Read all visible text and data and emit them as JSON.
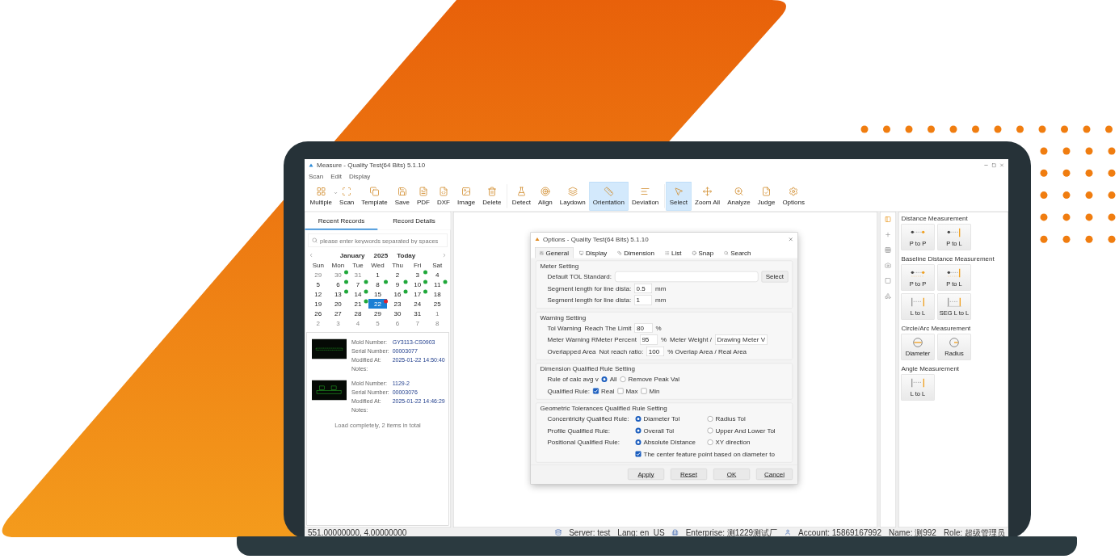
{
  "window": {
    "title": "Measure - Quality Test(64 Bits) 5.1.10"
  },
  "menu": [
    "Scan",
    "Edit",
    "Display"
  ],
  "toolbar": [
    {
      "items": [
        {
          "label": "Multiple",
          "selected": false,
          "dropdown": true
        },
        {
          "label": "Scan",
          "selected": false,
          "dropdown": false
        },
        {
          "label": "Template",
          "selected": false,
          "dropdown": false
        },
        {
          "label": "Save",
          "selected": false,
          "dropdown": false
        },
        {
          "label": "PDF",
          "selected": false,
          "dropdown": false
        },
        {
          "label": "DXF",
          "selected": false,
          "dropdown": false
        },
        {
          "label": "Image",
          "selected": false,
          "dropdown": false
        },
        {
          "label": "Delete",
          "selected": false,
          "dropdown": false
        }
      ]
    },
    {
      "items": [
        {
          "label": "Detect",
          "selected": false,
          "dropdown": false
        },
        {
          "label": "Align",
          "selected": false,
          "dropdown": false
        },
        {
          "label": "Laydown",
          "selected": false,
          "dropdown": false
        },
        {
          "label": "Orientation",
          "selected": true,
          "dropdown": false
        },
        {
          "label": "Deviation",
          "selected": false,
          "dropdown": false
        }
      ]
    },
    {
      "items": [
        {
          "label": "Select",
          "selected": true,
          "dropdown": false
        },
        {
          "label": "Zoom All",
          "selected": false,
          "dropdown": false
        },
        {
          "label": "Analyze",
          "selected": false,
          "dropdown": false
        },
        {
          "label": "Judge",
          "selected": false,
          "dropdown": false
        },
        {
          "label": "Options",
          "selected": false,
          "dropdown": false
        }
      ]
    }
  ],
  "left_panel": {
    "tabs": [
      {
        "label": "Recent Records",
        "selected": true
      },
      {
        "label": "Record Details",
        "selected": false
      }
    ],
    "search": {
      "placeholder": "please enter keywords separated by spaces"
    },
    "calendar": {
      "month": "January",
      "year": "2025",
      "today": "Today",
      "weekdays": [
        "Sun",
        "Mon",
        "Tue",
        "Wed",
        "Thu",
        "Fri",
        "Sat"
      ],
      "weeks": [
        [
          {
            "day": "29",
            "muted": true,
            "selected": false
          },
          {
            "day": "30",
            "muted": true,
            "selected": false,
            "color": "#1fa83a"
          },
          {
            "day": "31",
            "muted": true,
            "selected": false
          },
          {
            "day": "1",
            "muted": false,
            "selected": false
          },
          {
            "day": "2",
            "muted": false,
            "selected": false
          },
          {
            "day": "3",
            "muted": false,
            "selected": false,
            "color": "#1fa83a"
          },
          {
            "day": "4",
            "muted": false,
            "selected": false
          }
        ],
        [
          {
            "day": "5",
            "muted": false,
            "selected": false
          },
          {
            "day": "6",
            "muted": false,
            "selected": false,
            "color": "#1fa83a"
          },
          {
            "day": "7",
            "muted": false,
            "selected": false,
            "color": "#1fa83a"
          },
          {
            "day": "8",
            "muted": false,
            "selected": false,
            "color": "#1fa83a"
          },
          {
            "day": "9",
            "muted": false,
            "selected": false,
            "color": "#1fa83a"
          },
          {
            "day": "10",
            "muted": false,
            "selected": false,
            "color": "#1fa83a"
          },
          {
            "day": "11",
            "muted": false,
            "selected": false,
            "color": "#1fa83a"
          }
        ],
        [
          {
            "day": "12",
            "muted": false,
            "selected": false
          },
          {
            "day": "13",
            "muted": false,
            "selected": false,
            "color": "#1fa83a"
          },
          {
            "day": "14",
            "muted": false,
            "selected": false,
            "color": "#1fa83a"
          },
          {
            "day": "15",
            "muted": false,
            "selected": false
          },
          {
            "day": "16",
            "muted": false,
            "selected": false,
            "color": "#1fa83a"
          },
          {
            "day": "17",
            "muted": false,
            "selected": false,
            "color": "#1fa83a"
          },
          {
            "day": "18",
            "muted": false,
            "selected": false
          }
        ],
        [
          {
            "day": "19",
            "muted": false,
            "selected": false
          },
          {
            "day": "20",
            "muted": false,
            "selected": false
          },
          {
            "day": "21",
            "muted": false,
            "selected": false,
            "color": "#1fa83a"
          },
          {
            "day": "22",
            "muted": false,
            "selected": true,
            "color": "#e0242b"
          },
          {
            "day": "23",
            "muted": false,
            "selected": false
          },
          {
            "day": "24",
            "muted": false,
            "selected": false
          },
          {
            "day": "25",
            "muted": false,
            "selected": false
          }
        ],
        [
          {
            "day": "26",
            "muted": false,
            "selected": false
          },
          {
            "day": "27",
            "muted": false,
            "selected": false
          },
          {
            "day": "28",
            "muted": false,
            "selected": false
          },
          {
            "day": "29",
            "muted": false,
            "selected": false
          },
          {
            "day": "30",
            "muted": false,
            "selected": false
          },
          {
            "day": "31",
            "muted": false,
            "selected": false
          },
          {
            "day": "1",
            "muted": true,
            "selected": false
          }
        ],
        [
          {
            "day": "2",
            "muted": true,
            "selected": false
          },
          {
            "day": "3",
            "muted": true,
            "selected": false
          },
          {
            "day": "4",
            "muted": true,
            "selected": false
          },
          {
            "day": "5",
            "muted": true,
            "selected": false
          },
          {
            "day": "6",
            "muted": true,
            "selected": false
          },
          {
            "day": "7",
            "muted": true,
            "selected": false
          },
          {
            "day": "8",
            "muted": true,
            "selected": false
          }
        ]
      ]
    },
    "records": [
      {
        "fields": [
          {
            "label": "Mold Number:",
            "value": "GY3113-CS0903"
          },
          {
            "label": "Serial Number:",
            "value": "00003077"
          },
          {
            "label": "Modified At:",
            "value": "2025-01-22 14:50:40"
          },
          {
            "label": "Notes:"
          }
        ]
      },
      {
        "fields": [
          {
            "label": "Mold Number:",
            "value": "1129-2"
          },
          {
            "label": "Serial Number:",
            "value": "00003076"
          },
          {
            "label": "Modified At:",
            "value": "2025-01-22 14:46:29"
          },
          {
            "label": "Notes:"
          }
        ]
      }
    ],
    "records_footer": "Load completely, 2 items in total"
  },
  "dialog": {
    "title": "Options - Quality Test(64 Bits) 5.1.10",
    "tabs": [
      {
        "label": "General",
        "selected": true
      },
      {
        "label": "Display",
        "selected": false
      },
      {
        "label": "Dimension",
        "selected": false
      },
      {
        "label": "List",
        "selected": false
      },
      {
        "label": "Snap",
        "selected": false
      },
      {
        "label": "Search",
        "selected": false
      }
    ],
    "groups": [
      {
        "title": "Meter Setting",
        "rows": [
          [
            {
              "kind": "label",
              "text": "Default TOL Standard:"
            },
            {
              "kind": "textbox"
            },
            {
              "kind": "button",
              "text": "Select"
            }
          ],
          [
            {
              "kind": "label",
              "text": "Segment length for line dista:"
            },
            {
              "kind": "input",
              "value": "0.5"
            },
            {
              "kind": "text",
              "text": "mm"
            }
          ],
          [
            {
              "kind": "label",
              "text": "Segment length for line dista:"
            },
            {
              "kind": "input",
              "value": "1"
            },
            {
              "kind": "text",
              "text": "mm"
            }
          ]
        ]
      },
      {
        "title": "Warning Setting",
        "rows": [
          [
            {
              "kind": "label",
              "text": "Tol Warning"
            },
            {
              "kind": "text",
              "text": "Reach The Limit"
            },
            {
              "kind": "input",
              "value": "80"
            },
            {
              "kind": "text",
              "text": "%"
            }
          ],
          [
            {
              "kind": "label",
              "text": "Meter Warning RMeter Percent"
            },
            {
              "kind": "input",
              "value": "95"
            },
            {
              "kind": "text",
              "text": "%"
            },
            {
              "kind": "text",
              "text": "Meter Weight /"
            },
            {
              "kind": "select",
              "value": "Drawing Meter V"
            }
          ],
          [
            {
              "kind": "label",
              "text": "Overlapped Area"
            },
            {
              "kind": "text",
              "text": "Not reach ratio:"
            },
            {
              "kind": "input",
              "value": "100"
            },
            {
              "kind": "text",
              "text": "% Overlap Area / Real Area"
            }
          ]
        ]
      },
      {
        "title": "Dimension Qualified Rule Setting",
        "rows": [
          [
            {
              "kind": "label",
              "text": "Rule of calc avg v"
            },
            {
              "kind": "radio",
              "text": "All",
              "selected": true
            },
            {
              "kind": "radio",
              "text": "Remove Peak Val",
              "selected": false
            }
          ],
          [
            {
              "kind": "label",
              "text": "Qualified Rule:"
            },
            {
              "kind": "checkbox",
              "text": "Real",
              "checked": true
            },
            {
              "kind": "checkbox",
              "text": "Max",
              "checked": false
            },
            {
              "kind": "checkbox",
              "text": "Min",
              "checked": false
            }
          ]
        ]
      },
      {
        "title": "Geometric Tolerances Qualified Rule Setting",
        "rows": [
          [
            {
              "kind": "label",
              "text": "Concentricity Qualified Rule:"
            },
            {
              "kind": "radio",
              "text": "Diameter Tol",
              "selected": true
            },
            {
              "kind": "radio",
              "text": "Radius Tol",
              "selected": false
            }
          ],
          [
            {
              "kind": "label",
              "text": "Profile Qualified Rule:"
            },
            {
              "kind": "radio",
              "text": "Overall Tol",
              "selected": true
            },
            {
              "kind": "radio",
              "text": "Upper And Lower Tol",
              "selected": false
            }
          ],
          [
            {
              "kind": "label",
              "text": "Positional Qualified Rule:"
            },
            {
              "kind": "radio",
              "text": "Absolute Distance",
              "selected": true
            },
            {
              "kind": "radio",
              "text": "XY direction",
              "selected": false
            }
          ],
          [
            "",
            {
              "kind": "checkbox",
              "text": "The center feature point based on diameter to",
              "checked": true
            }
          ]
        ]
      }
    ],
    "buttons": [
      "Apply",
      "Reset",
      "OK",
      "Cancel"
    ]
  },
  "tool_strip": [
    {
      "selected": true
    },
    {
      "selected": false
    },
    {
      "selected": false
    },
    {
      "selected": false
    },
    {
      "selected": false
    },
    {
      "selected": false
    }
  ],
  "measure_panel": [
    {
      "title": "Distance Measurement",
      "tools": [
        {
          "kind": "p2p",
          "label": "P to P"
        },
        {
          "kind": "p2l",
          "label": "P to L"
        }
      ]
    },
    {
      "title": "Baseline Distance Measurement",
      "tools": [
        {
          "kind": "base-p2p",
          "label": "P to P"
        },
        {
          "kind": "base-p2l",
          "label": "P to L"
        },
        {
          "kind": "l2l",
          "label": "L to L"
        },
        {
          "kind": "seg",
          "label": "SEG L to L"
        }
      ]
    },
    {
      "title": "Circle/Arc Measurement",
      "tools": [
        {
          "kind": "diameter",
          "label": "Diameter"
        },
        {
          "kind": "radius",
          "label": "Radius"
        }
      ]
    },
    {
      "title": "Angle Measurement",
      "tools": [
        {
          "kind": "l2l",
          "label": "L to L"
        }
      ]
    }
  ],
  "status_bar": {
    "coordinates": "551.00000000, 4.00000000",
    "items": [
      "Server: test",
      "Lang: en_US",
      "Enterprise: 测1229测试厂",
      "Account: 15869167992",
      "Name: 测992",
      "Role: 超级管理员"
    ]
  }
}
